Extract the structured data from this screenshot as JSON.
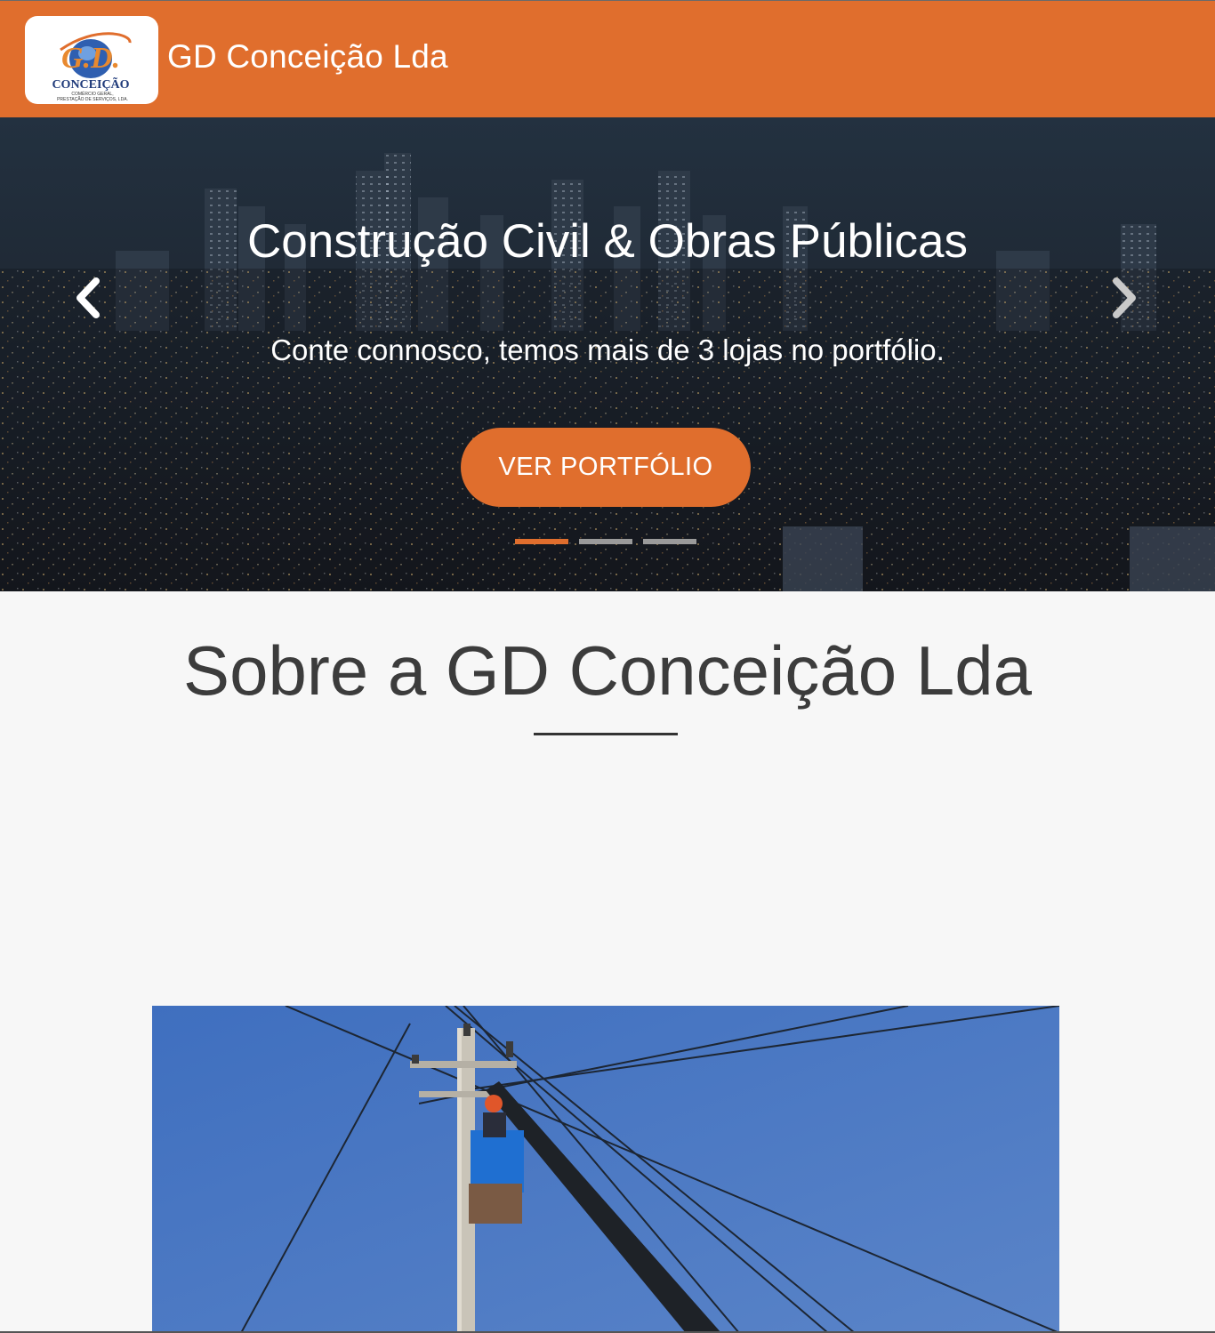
{
  "header": {
    "brand": "GD Conceição Lda",
    "logo_text": {
      "mark": "G.D.",
      "name": "CONCEIÇÃO",
      "tagline_1": "COMÉRCIO GERAL,",
      "tagline_2": "PRESTAÇÃO DE SERVIÇOS, LDA."
    }
  },
  "hero": {
    "title": "Construção Civil & Obras Públicas",
    "subtitle": "Conte connosco, temos mais de 3 lojas no portfólio.",
    "button_label": "VER PORTFÓLIO",
    "slides": 3,
    "active_slide": 1
  },
  "about": {
    "title": "Sobre a GD Conceição Lda"
  },
  "colors": {
    "brand": "#e06e2d",
    "page_bg": "#f7f7f7",
    "heading": "#3c3c3c"
  },
  "icons": {
    "prev": "chevron-left-icon",
    "next": "chevron-right-icon"
  }
}
